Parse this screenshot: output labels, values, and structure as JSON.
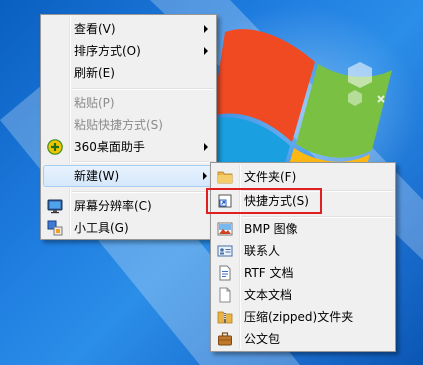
{
  "context_menu": {
    "items": [
      {
        "label": "查看(V)",
        "submenu": true
      },
      {
        "label": "排序方式(O)",
        "submenu": true
      },
      {
        "label": "刷新(E)"
      },
      {
        "label": "粘贴(P)",
        "disabled": true
      },
      {
        "label": "粘贴快捷方式(S)",
        "disabled": true
      },
      {
        "label": "360桌面助手",
        "submenu": true,
        "icon": "360-assistant-icon"
      },
      {
        "label": "新建(W)",
        "submenu": true,
        "highlighted": true
      },
      {
        "label": "屏幕分辨率(C)",
        "icon": "display-resolution-icon"
      },
      {
        "label": "小工具(G)",
        "icon": "gadgets-icon"
      }
    ]
  },
  "new_submenu": {
    "items": [
      {
        "label": "文件夹(F)",
        "icon": "folder-icon"
      },
      {
        "label": "快捷方式(S)",
        "icon": "shortcut-icon",
        "outlined": true
      },
      {
        "label": "BMP 图像",
        "icon": "bitmap-image-icon"
      },
      {
        "label": "联系人",
        "icon": "contact-icon"
      },
      {
        "label": "RTF 文档",
        "icon": "rtf-document-icon"
      },
      {
        "label": "文本文档",
        "icon": "text-document-icon"
      },
      {
        "label": "压缩(zipped)文件夹",
        "icon": "zip-folder-icon"
      },
      {
        "label": "公文包",
        "icon": "briefcase-icon"
      }
    ]
  },
  "colors": {
    "menu_background": "#f0f0f0",
    "highlight_outline": "#e02020",
    "hover_background": "#d5e8fc",
    "disabled_text": "#8b8b8b"
  }
}
